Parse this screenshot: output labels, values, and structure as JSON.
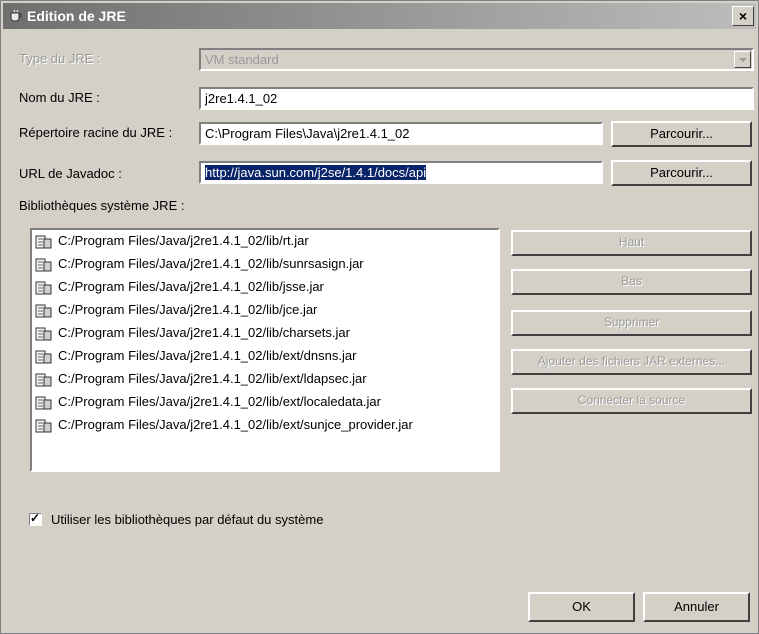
{
  "window": {
    "title": "Edition de JRE",
    "close": "×"
  },
  "form": {
    "jre_type": {
      "label": "Type du JRE :",
      "value": "VM standard"
    },
    "jre_name": {
      "label": "Nom du JRE :",
      "value": "j2re1.4.1_02"
    },
    "jre_home": {
      "label": "Répertoire racine du JRE :",
      "value": "C:\\Program Files\\Java\\j2re1.4.1_02",
      "browse": "Parcourir..."
    },
    "javadoc": {
      "label": "URL de Javadoc :",
      "value": "http://java.sun.com/j2se/1.4.1/docs/api",
      "browse": "Parcourir..."
    }
  },
  "libraries": {
    "label": "Bibliothèques système JRE :",
    "items": [
      "C:/Program Files/Java/j2re1.4.1_02/lib/rt.jar",
      "C:/Program Files/Java/j2re1.4.1_02/lib/sunrsasign.jar",
      "C:/Program Files/Java/j2re1.4.1_02/lib/jsse.jar",
      "C:/Program Files/Java/j2re1.4.1_02/lib/jce.jar",
      "C:/Program Files/Java/j2re1.4.1_02/lib/charsets.jar",
      "C:/Program Files/Java/j2re1.4.1_02/lib/ext/dnsns.jar",
      "C:/Program Files/Java/j2re1.4.1_02/lib/ext/ldapsec.jar",
      "C:/Program Files/Java/j2re1.4.1_02/lib/ext/localedata.jar",
      "C:/Program Files/Java/j2re1.4.1_02/lib/ext/sunjce_provider.jar"
    ],
    "buttons": {
      "up": "Haut",
      "down": "Bas",
      "remove": "Supprimer",
      "add_external": "Ajouter des fichiers JAR externes...",
      "attach_source": "Connecter la source"
    }
  },
  "use_default": {
    "label": "Utiliser les bibliothèques par défaut du système",
    "checked": true
  },
  "footer": {
    "ok": "OK",
    "cancel": "Annuler"
  },
  "icons": {
    "window_icon": "coffee-cup-icon",
    "library_icon": "jar-file-icon",
    "combo_arrow": "chevron-down-icon"
  }
}
